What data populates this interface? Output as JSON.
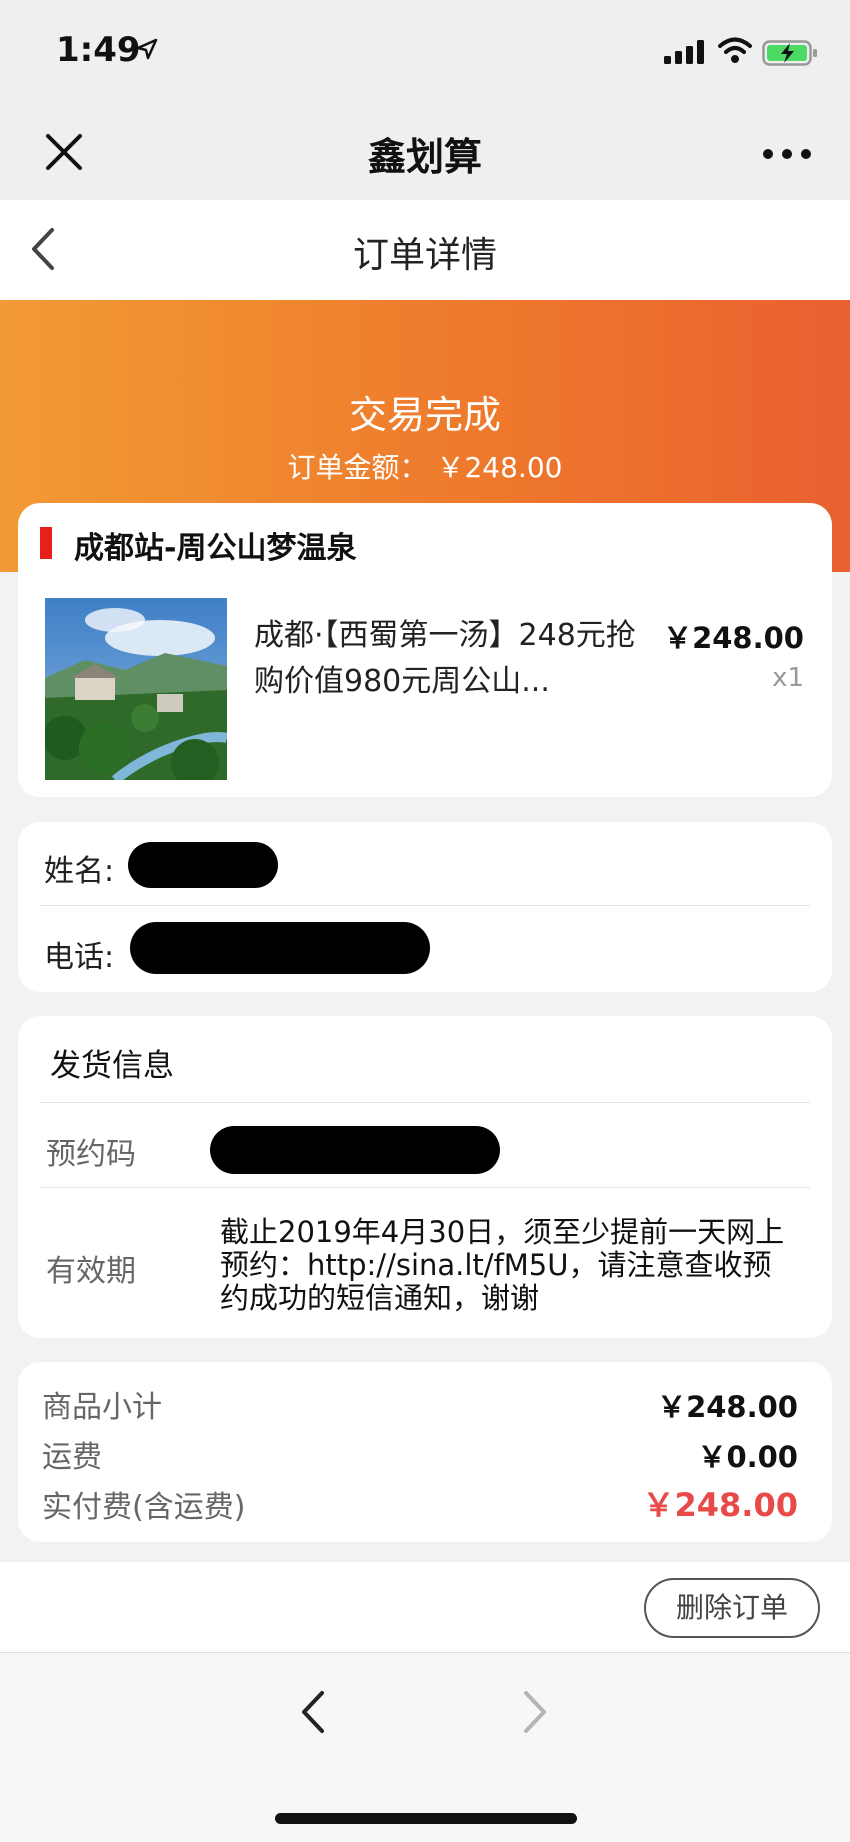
{
  "status_bar": {
    "time": "1:49"
  },
  "app_bar": {
    "title": "鑫划算"
  },
  "page_nav": {
    "title": "订单详情"
  },
  "banner": {
    "status": "交易完成",
    "amount_label": "订单金额：",
    "amount": "￥248.00"
  },
  "shop": {
    "name": "成都站-周公山梦温泉"
  },
  "product": {
    "title": "成都·【西蜀第一汤】248元抢购价值980元周公山...",
    "price": "￥248.00",
    "quantity": "x1"
  },
  "contact": {
    "name_label": "姓名:",
    "phone_label": "电话:"
  },
  "shipping": {
    "title": "发货信息",
    "code_label": "预约码",
    "validity_label": "有效期",
    "validity_text": "截止2019年4月30日，须至少提前一天网上预约：http://sina.lt/fM5U，请注意查收预约成功的短信通知，谢谢"
  },
  "totals": {
    "subtotal_label": "商品小计",
    "subtotal": "￥248.00",
    "shipping_label": "运费",
    "shipping": "￥0.00",
    "paid_label": "实付费(含运费)",
    "paid": "￥248.00"
  },
  "actions": {
    "delete_label": "删除订单"
  },
  "colors": {
    "banner_start": "#f29a35",
    "banner_end": "#ea6030",
    "price_red": "#e84a4a",
    "shop_marker": "#e8201c"
  }
}
